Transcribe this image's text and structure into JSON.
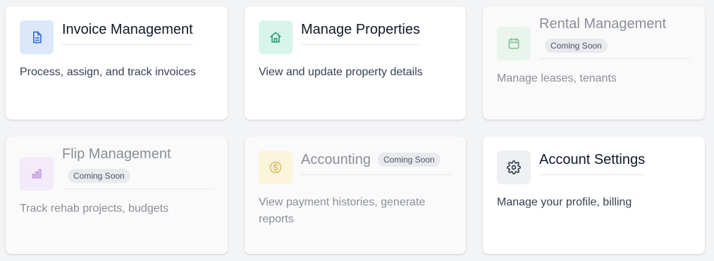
{
  "cards": [
    {
      "title": "Invoice Management",
      "description": "Process, assign, and track invoices",
      "icon": "document-icon",
      "icon_bg": "#dbe7fb",
      "icon_color": "#3b6fd8"
    },
    {
      "title": "Manage Properties",
      "description": "View and update property details",
      "icon": "home-icon",
      "icon_bg": "#d8f5ec",
      "icon_color": "#2a9d77"
    },
    {
      "title": "Rental Management",
      "badge": "Coming Soon",
      "description": "Manage leases, tenants",
      "icon": "calendar-icon",
      "icon_bg": "#dff3e3",
      "icon_color": "#3aa05a"
    },
    {
      "title": "Flip Management",
      "badge": "Coming Soon",
      "description": "Track rehab projects, budgets",
      "icon": "bar-chart-icon",
      "icon_bg": "#efe0fa",
      "icon_color": "#a05fd8"
    },
    {
      "title": "Accounting",
      "badge": "Coming Soon",
      "description": "View payment histories, generate reports",
      "icon": "dollar-icon",
      "icon_bg": "#fbf1c8",
      "icon_color": "#c79a12"
    },
    {
      "title": "Account Settings",
      "description": "Manage your profile, billing",
      "icon": "gear-icon",
      "icon_bg": "#eef0f3",
      "icon_color": "#374151"
    }
  ]
}
